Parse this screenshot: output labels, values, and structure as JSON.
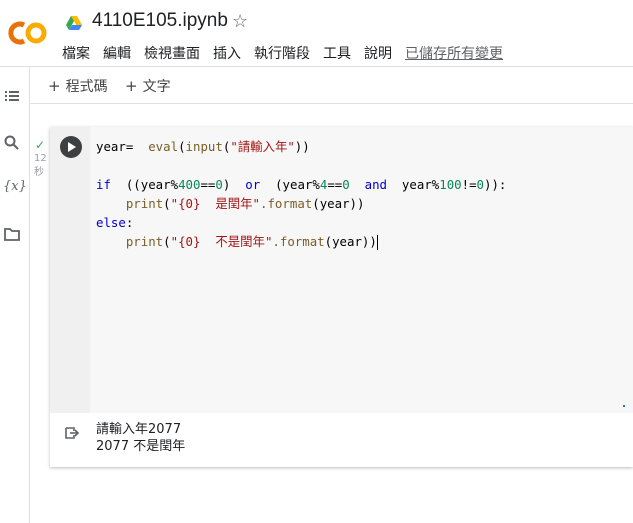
{
  "app": {
    "logo_text": "CO",
    "title": "4110E105.ipynb",
    "star_icon": "star-outline-icon"
  },
  "menu": {
    "items": [
      "檔案",
      "編輯",
      "檢視畫面",
      "插入",
      "執行階段",
      "工具",
      "說明"
    ],
    "saved_status": "已儲存所有變更"
  },
  "sidebar": {
    "icons": [
      "table-of-contents-icon",
      "search-icon",
      "variables-icon",
      "folder-icon"
    ],
    "variables_label": "{x}"
  },
  "toolbar": {
    "add_code_label": "程式碼",
    "add_text_label": "文字"
  },
  "cell": {
    "exec_status": "✓",
    "exec_time": "12\n秒",
    "code_lines": [
      "year=  eval(input(\"請輸入年\"))",
      "",
      "if  ((year%400==0)  or  (year%4==0  and  year%100!=0)):",
      "    print(\"{0}  是閏年\".format(year))",
      "else:",
      "    print(\"{0}  不是閏年\".format(year))"
    ],
    "output_lines": [
      "請輸入年2077",
      "2077 不是閏年"
    ]
  },
  "colors": {
    "keyword": "#0000c8",
    "string": "#a31515",
    "number": "#098658",
    "logo_orange": "#f9ab00",
    "logo_dark": "#e8710a"
  }
}
